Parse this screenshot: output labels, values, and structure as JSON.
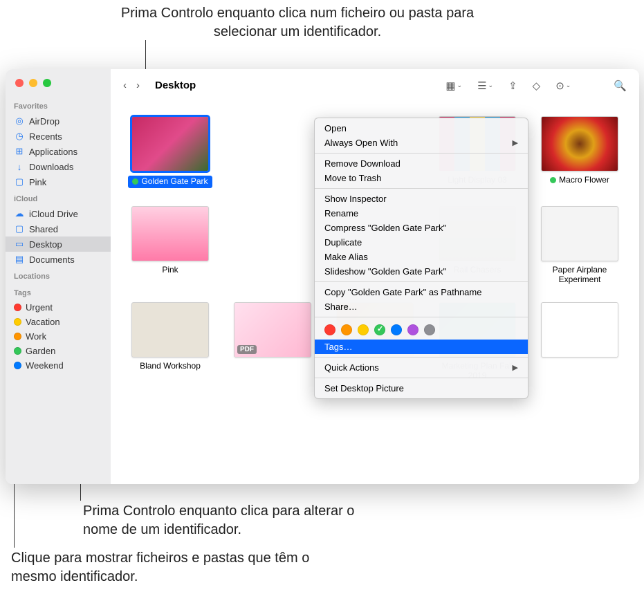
{
  "annotations": {
    "top": "Prima Controlo enquanto clica num ficheiro\nou pasta para selecionar um identificador.",
    "mid": "Prima Controlo enquanto clica para\nalterar o nome de um identificador.",
    "bottom": "Clique para mostrar ficheiros e pastas\nque têm o mesmo identificador."
  },
  "traffic_colors": [
    "#ff5f57",
    "#febc2e",
    "#28c840"
  ],
  "toolbar": {
    "title": "Desktop"
  },
  "sidebar": {
    "sections": [
      {
        "header": "Favorites",
        "items": [
          {
            "icon": "airdrop",
            "label": "AirDrop"
          },
          {
            "icon": "clock",
            "label": "Recents"
          },
          {
            "icon": "apps",
            "label": "Applications"
          },
          {
            "icon": "download",
            "label": "Downloads"
          },
          {
            "icon": "folder",
            "label": "Pink"
          }
        ]
      },
      {
        "header": "iCloud",
        "items": [
          {
            "icon": "cloud",
            "label": "iCloud Drive"
          },
          {
            "icon": "folder",
            "label": "Shared"
          },
          {
            "icon": "desktop",
            "label": "Desktop",
            "selected": true
          },
          {
            "icon": "doc",
            "label": "Documents"
          }
        ]
      },
      {
        "header": "Locations",
        "items": []
      },
      {
        "header": "Tags",
        "items": [
          {
            "tag_color": "#ff3b30",
            "label": "Urgent"
          },
          {
            "tag_color": "#ffcc00",
            "label": "Vacation"
          },
          {
            "tag_color": "#ff9500",
            "label": "Work"
          },
          {
            "tag_color": "#34c759",
            "label": "Garden"
          },
          {
            "tag_color": "#007aff",
            "label": "Weekend"
          }
        ]
      }
    ]
  },
  "files": [
    {
      "name": "Golden Gate Park",
      "tag": "#34c759",
      "selected": true,
      "bg": "linear-gradient(135deg,#c62a64,#e14b8a 50%,#3a6b2e)"
    },
    {
      "name": "",
      "hidden_by_menu": true,
      "bg": "#ddd"
    },
    {
      "name": "",
      "hidden_by_menu": true,
      "bg": "#ddd"
    },
    {
      "name": "Light Display 03",
      "bg": "linear-gradient(90deg,#d62861 0%,#d62861 20%,#1e9fe6 20%,#1e9fe6 40%,#ffd63b 40%,#ffd63b 60%,#1e9fe6 60%,#1e9fe6 80%,#d62861 80%)"
    },
    {
      "name": "Macro Flower",
      "tag": "#34c759",
      "bg": "radial-gradient(circle at 50% 50%,#7a3a12 0%,#e0a018 30%,#d62828 60%,#7a0f0f 100%)"
    },
    {
      "name": "Pink",
      "bg": "linear-gradient(180deg,#ffd0e2,#ff7aa8)"
    },
    {
      "name": "",
      "hidden_by_menu": true,
      "bg": "#ddd"
    },
    {
      "name": "",
      "hidden_by_menu": true,
      "bg": "#ddd"
    },
    {
      "name": "Rail Chasers",
      "bg": "linear-gradient(180deg,#d8d4c0,#8aa86f)"
    },
    {
      "name": "Paper Airplane Experiment",
      "bg": "#f4f4f4"
    },
    {
      "name": "Bland Workshop",
      "bg": "#e8e3d8"
    },
    {
      "name": "",
      "pdf": true,
      "bg": "linear-gradient(135deg,#ffe0ee,#ffb8d2)"
    },
    {
      "name": "",
      "pdf": true,
      "bg": "linear-gradient(135deg,#ff9c3c,#ffd38a)"
    },
    {
      "name": "Marketing Plan Fall 2019",
      "pdf": true,
      "bg": "linear-gradient(135deg,#1aa3a3,#2bc4b0)"
    },
    {
      "name": "",
      "bg": "#fff"
    }
  ],
  "context_menu": {
    "items": [
      {
        "label": "Open"
      },
      {
        "label": "Always Open With",
        "submenu": true
      },
      {
        "sep": true
      },
      {
        "label": "Remove Download"
      },
      {
        "label": "Move to Trash"
      },
      {
        "sep": true
      },
      {
        "label": "Show Inspector"
      },
      {
        "label": "Rename"
      },
      {
        "label": "Compress \"Golden Gate Park\""
      },
      {
        "label": "Duplicate"
      },
      {
        "label": "Make Alias"
      },
      {
        "label": "Slideshow \"Golden Gate Park\""
      },
      {
        "sep": true
      },
      {
        "label": "Copy \"Golden Gate Park\" as Pathname"
      },
      {
        "label": "Share…"
      },
      {
        "sep": true
      },
      {
        "colors": true
      },
      {
        "label": "Tags…",
        "highlight": true
      },
      {
        "sep": true
      },
      {
        "label": "Quick Actions",
        "submenu": true
      },
      {
        "sep": true
      },
      {
        "label": "Set Desktop Picture"
      }
    ],
    "colors": [
      {
        "hex": "#ff3b30"
      },
      {
        "hex": "#ff9500"
      },
      {
        "hex": "#ffcc00"
      },
      {
        "hex": "#34c759",
        "checked": true
      },
      {
        "hex": "#007aff"
      },
      {
        "hex": "#af52de"
      },
      {
        "hex": "#8e8e93"
      }
    ]
  },
  "pdf_label": "PDF"
}
